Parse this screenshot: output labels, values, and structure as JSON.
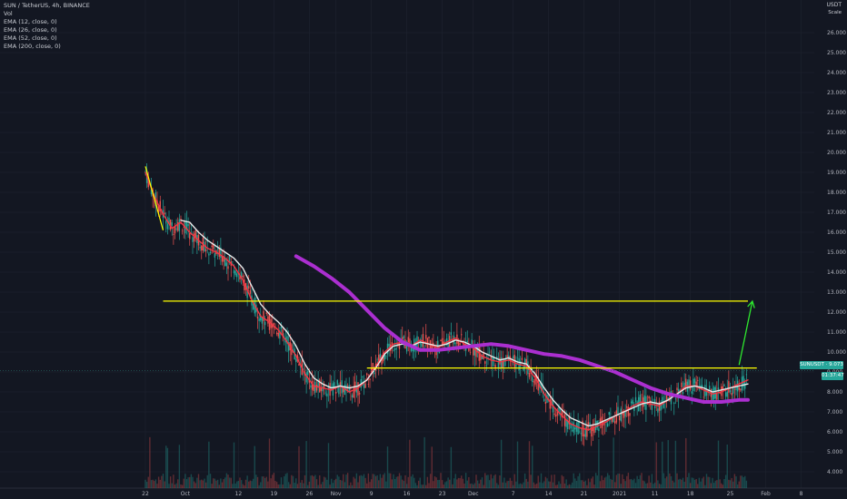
{
  "legend": {
    "title": "SUN / TetherUS, 4h, BINANCE",
    "vol": "Vol",
    "ema1": "EMA (12, close, 0)",
    "ema2": "EMA (26, close, 0)",
    "ema3": "EMA (52, close, 0)",
    "ema4": "EMA (200, close, 0)"
  },
  "price_axis_unit": "USDT",
  "price_axis_mode": "Scale",
  "badges": {
    "symbol_price": "SUNUSDT · 9.073",
    "countdown": "01:37:47"
  },
  "colors": {
    "background": "#131722",
    "grid": "#1f2430",
    "ema_fast": "#f23645",
    "ema_slow": "#e8e8e8",
    "ema_200": "#ab2fd0",
    "trendline": "#ffff00",
    "arrow": "#2ee82e",
    "up_candle": "#26a69a",
    "down_candle": "#ef5350"
  },
  "chart_data": {
    "type": "line",
    "xlabel": "",
    "ylabel": "",
    "x_ticks": [
      "22",
      "Oct",
      "12",
      "19",
      "26",
      "Nov",
      "9",
      "16",
      "23",
      "Dec",
      "7",
      "14",
      "21",
      "2021",
      "11",
      "18",
      "25",
      "Feb",
      "8"
    ],
    "y_ticks": [
      "4.000",
      "5.000",
      "6.000",
      "7.000",
      "8.000",
      "9.000",
      "10.000",
      "11.000",
      "12.000",
      "13.000",
      "14.000",
      "15.000",
      "16.000",
      "17.000",
      "18.000",
      "19.000",
      "20.000",
      "21.000",
      "22.000",
      "23.000",
      "24.000",
      "25.000",
      "26.000"
    ],
    "ylim": [
      3.5,
      26.5
    ],
    "xlim": [
      0,
      72
    ],
    "x_positions_note": "x = trading days since Sep 22",
    "series": [
      {
        "name": "EMA (12, close, 0)",
        "color": "#f23645",
        "x": [
          0,
          1,
          2,
          3,
          4,
          5,
          6,
          7,
          8,
          9,
          10,
          11,
          12,
          13,
          14,
          15,
          16,
          17,
          18,
          19,
          20,
          21,
          22,
          23,
          24,
          25,
          26,
          27,
          28,
          29,
          30,
          31,
          32,
          33,
          34,
          35,
          36,
          37,
          38,
          39,
          40,
          41,
          42,
          43,
          44,
          45,
          46,
          47,
          48,
          49,
          50,
          51,
          52,
          53,
          54,
          55,
          56,
          57,
          58,
          59,
          60,
          61,
          62,
          63,
          64,
          65,
          66,
          67,
          68
        ],
        "values": [
          19.0,
          17.8,
          16.9,
          16.2,
          16.5,
          16.0,
          15.6,
          15.2,
          15.0,
          14.7,
          14.3,
          13.6,
          12.6,
          11.8,
          11.5,
          11.1,
          10.5,
          9.8,
          8.9,
          8.3,
          8.2,
          8.1,
          8.3,
          8.0,
          8.2,
          8.6,
          9.3,
          10.0,
          10.4,
          10.5,
          10.3,
          10.6,
          10.4,
          10.2,
          10.5,
          10.7,
          10.4,
          10.2,
          9.8,
          9.6,
          9.5,
          9.6,
          9.4,
          9.3,
          8.7,
          7.9,
          7.3,
          6.8,
          6.4,
          6.2,
          6.1,
          6.3,
          6.5,
          6.8,
          7.0,
          7.3,
          7.5,
          7.4,
          7.3,
          7.6,
          7.9,
          8.3,
          8.3,
          8.1,
          7.9,
          8.0,
          8.2,
          8.4,
          8.6
        ]
      },
      {
        "name": "EMA (26, close, 0)",
        "color": "#e8e8e8",
        "x": [
          4,
          5,
          6,
          7,
          8,
          9,
          10,
          11,
          12,
          13,
          14,
          15,
          16,
          17,
          18,
          19,
          20,
          21,
          22,
          23,
          24,
          25,
          26,
          27,
          28,
          29,
          30,
          31,
          32,
          33,
          34,
          35,
          36,
          37,
          38,
          39,
          40,
          41,
          42,
          43,
          44,
          45,
          46,
          47,
          48,
          49,
          50,
          51,
          52,
          53,
          54,
          55,
          56,
          57,
          58,
          59,
          60,
          61,
          62,
          63,
          64,
          65,
          66,
          67,
          68
        ],
        "values": [
          16.6,
          16.5,
          16.0,
          15.6,
          15.3,
          15.0,
          14.7,
          14.2,
          13.3,
          12.4,
          11.9,
          11.5,
          11.0,
          10.3,
          9.4,
          8.7,
          8.4,
          8.2,
          8.3,
          8.2,
          8.3,
          8.6,
          9.2,
          9.9,
          10.3,
          10.4,
          10.3,
          10.5,
          10.4,
          10.3,
          10.4,
          10.6,
          10.5,
          10.3,
          10.0,
          9.8,
          9.6,
          9.7,
          9.5,
          9.4,
          8.9,
          8.2,
          7.6,
          7.1,
          6.7,
          6.5,
          6.3,
          6.4,
          6.6,
          6.8,
          7.0,
          7.2,
          7.4,
          7.5,
          7.4,
          7.6,
          7.9,
          8.2,
          8.3,
          8.2,
          8.0,
          8.1,
          8.2,
          8.3,
          8.4
        ]
      },
      {
        "name": "EMA (200, close, 0)",
        "color": "#ab2fd0",
        "x": [
          17,
          19,
          21,
          23,
          25,
          27,
          29,
          31,
          33,
          35,
          37,
          39,
          41,
          43,
          45,
          47,
          49,
          51,
          53,
          55,
          57,
          59,
          61,
          63,
          65,
          67,
          68
        ],
        "values": [
          14.8,
          14.3,
          13.7,
          13.0,
          12.1,
          11.2,
          10.5,
          10.1,
          10.1,
          10.2,
          10.3,
          10.4,
          10.3,
          10.1,
          9.9,
          9.8,
          9.6,
          9.3,
          9.0,
          8.6,
          8.2,
          7.9,
          7.7,
          7.5,
          7.5,
          7.6,
          7.6
        ]
      }
    ],
    "annotations": {
      "resistance_line": {
        "x0": 2,
        "x1": 68,
        "y": 12.55,
        "color": "#ffff00"
      },
      "support_line": {
        "x0": 25,
        "x1": 69,
        "y": 9.2,
        "color": "#ffff00"
      },
      "early_trendline": {
        "x0": 0,
        "x1": 2,
        "y0": 19.3,
        "y1": 16.1,
        "color": "#ffff00"
      },
      "arrow": {
        "x0": 67,
        "y0": 9.35,
        "x1": 68.5,
        "y1": 12.55,
        "color": "#2ee82e"
      },
      "current_price": 9.073
    }
  }
}
